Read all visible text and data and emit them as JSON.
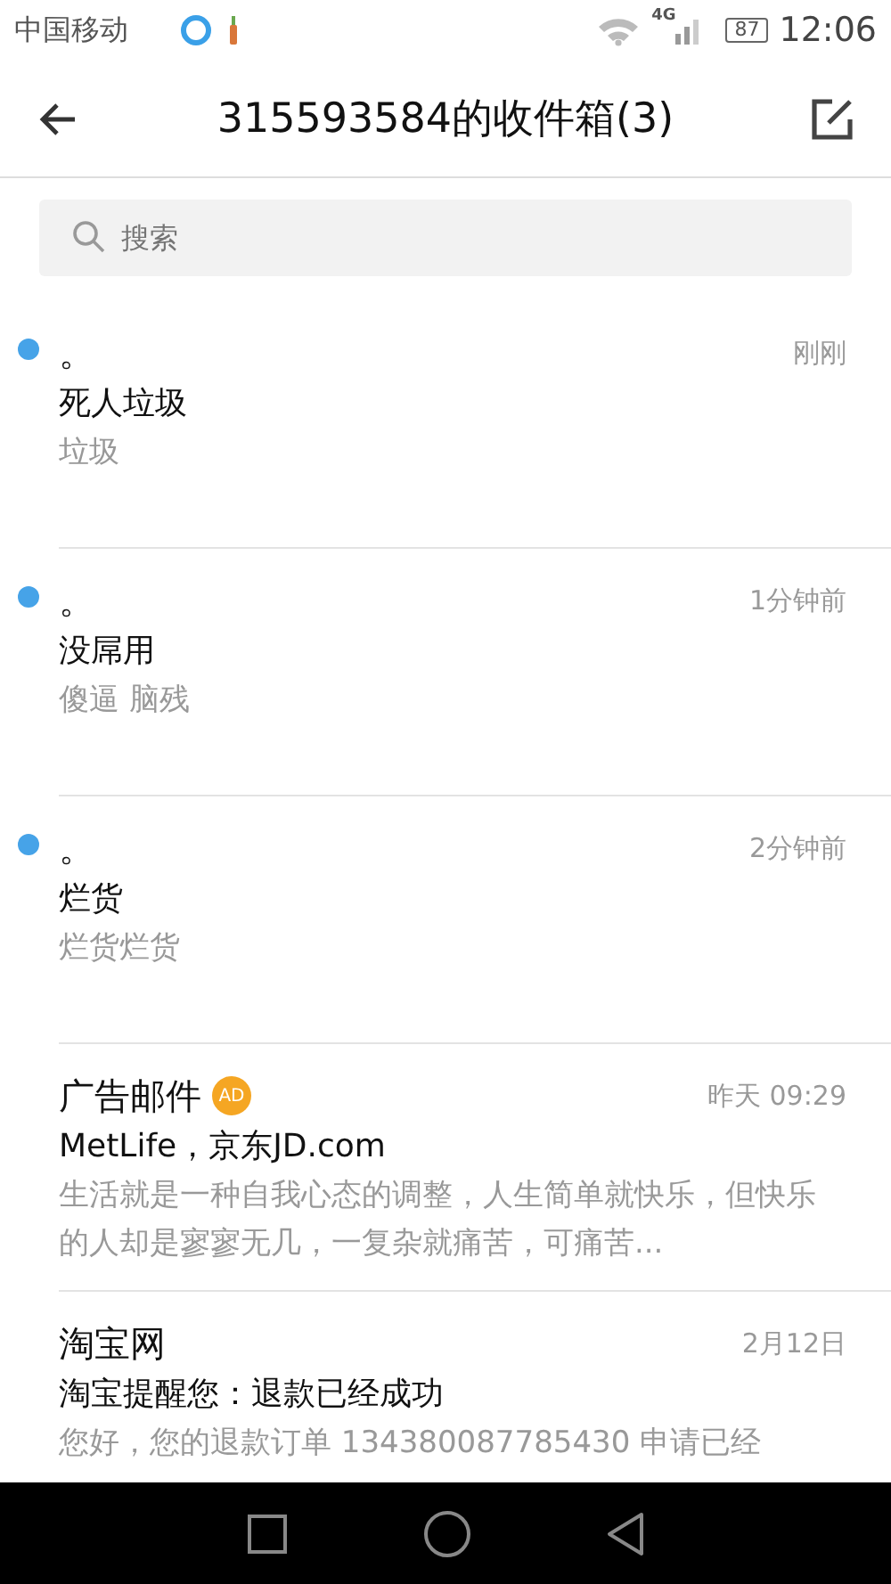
{
  "status_bar": {
    "carrier": "中国移动",
    "network": "4G",
    "battery": "87",
    "time": "12:06"
  },
  "header": {
    "title": "315593584的收件箱(3)"
  },
  "search": {
    "placeholder": "搜索"
  },
  "mails": [
    {
      "sender": "。",
      "time": "刚刚",
      "subject": "死人垃圾",
      "preview": "垃圾",
      "unread": true
    },
    {
      "sender": "。",
      "time": "1分钟前",
      "subject": "没屌用",
      "preview": "傻逼 脑残",
      "unread": true
    },
    {
      "sender": "。",
      "time": "2分钟前",
      "subject": "烂货",
      "preview": "烂货烂货",
      "unread": true
    },
    {
      "sender": "广告邮件",
      "badge": "AD",
      "time": "昨天 09:29",
      "subject": "MetLife，京东JD.com",
      "preview": "生活就是一种自我心态的调整，人生简单就快乐，但快乐的人却是寥寥无几，一复杂就痛苦，可痛苦...",
      "unread": false
    },
    {
      "sender": "淘宝网",
      "time": "2月12日",
      "subject": "淘宝提醒您：退款已经成功",
      "preview": "您好，您的退款订单 134380087785430 申请已经",
      "unread": false
    }
  ]
}
